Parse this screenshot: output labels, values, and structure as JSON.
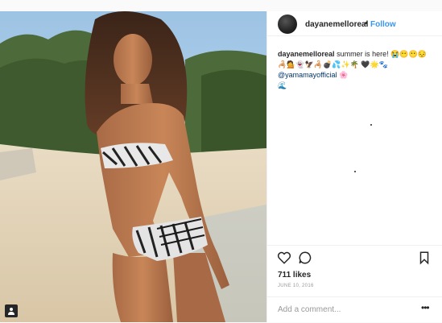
{
  "post": {
    "username": "dayanemelloreal",
    "separator": "•",
    "follow_label": "Follow",
    "caption_user": "dayanemelloreal",
    "caption_text": "summer is here! 😭😶😶😔",
    "caption_emoji_line": "🦂💁👻🦅🦂💣💦✨🌴 🖤🌟🐾",
    "caption_mention": "@yamamayofficial",
    "caption_tail": "🌸",
    "caption_emoji_line2": "🌊",
    "likes": "711 likes",
    "date": "JUNE 10, 2016",
    "comment_placeholder": "Add a comment...",
    "more_label": "•••"
  },
  "icons": {
    "like": "heart-outline-icon",
    "comment": "comment-bubble-icon",
    "save": "bookmark-icon",
    "tag": "person-tag-icon"
  },
  "colors": {
    "link": "#3897f0",
    "mention": "#003569",
    "text": "#262626",
    "muted": "#999999"
  }
}
